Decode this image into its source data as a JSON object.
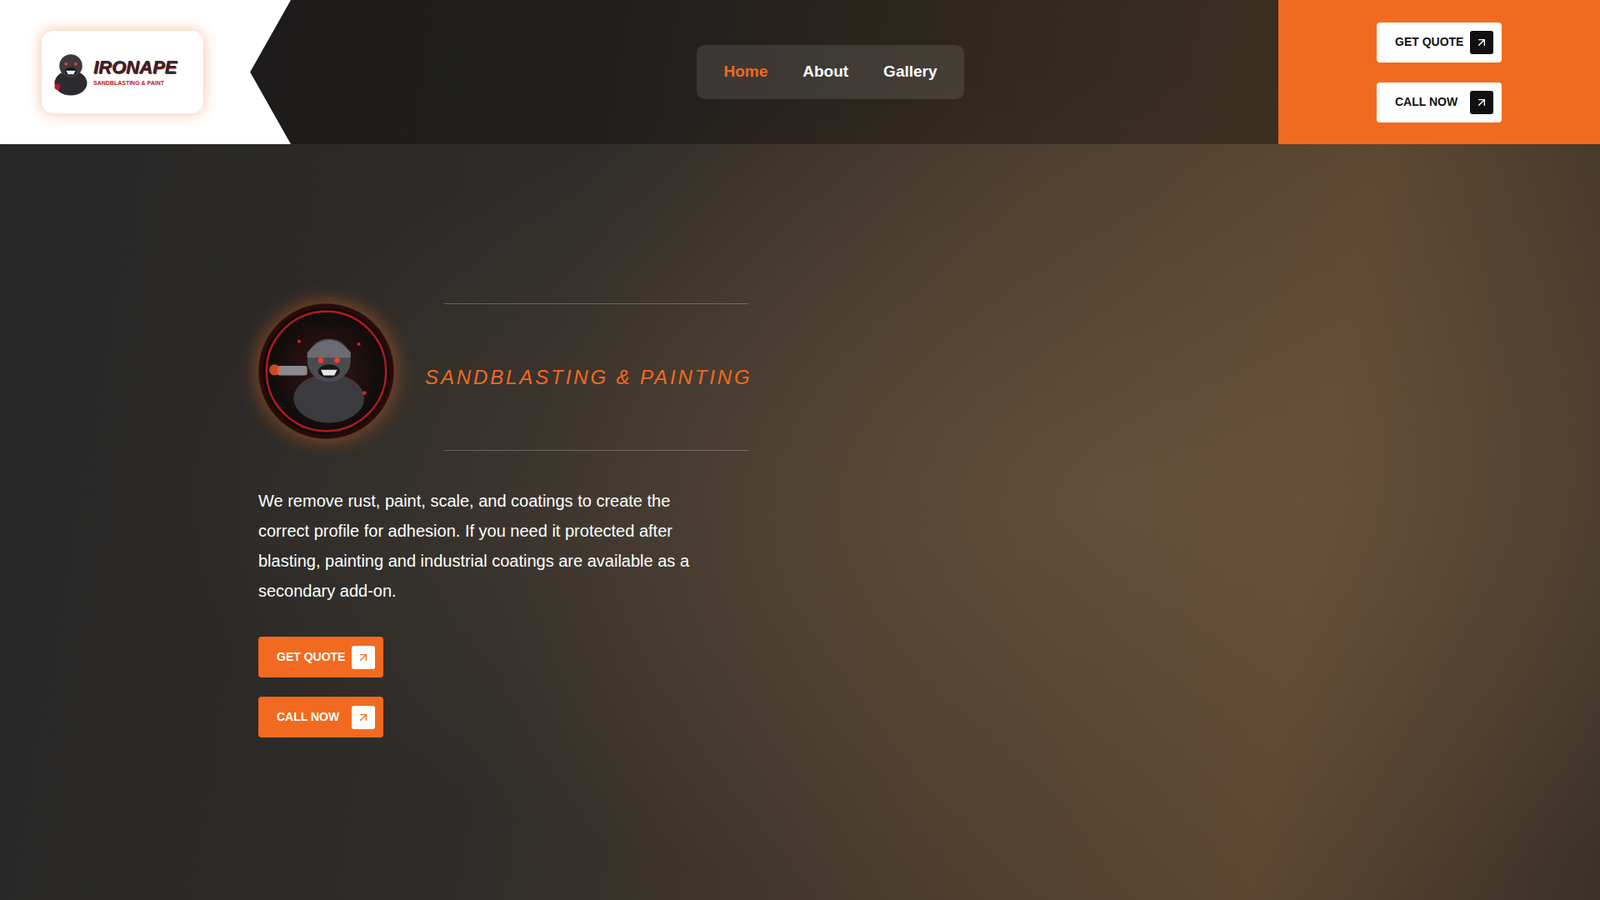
{
  "logo": {
    "name": "IRONAPE",
    "tagline": "SANDBLASTING & PAINT"
  },
  "nav": [
    {
      "label": "Home",
      "selected": true
    },
    {
      "label": "About",
      "selected": false
    },
    {
      "label": "Gallery",
      "selected": false
    }
  ],
  "header_buttons": [
    "GET QUOTE",
    "CALL NOW"
  ],
  "hero": {
    "title": "SANDBLASTING & PAINTING",
    "description": "We remove rust, paint, scale, and coatings to create the correct profile for adhesion. If you need it protected after blasting, painting and industrial coatings are available as a secondary add-on.",
    "buttons": [
      "GET QUOTE",
      "CALL NOW"
    ]
  }
}
